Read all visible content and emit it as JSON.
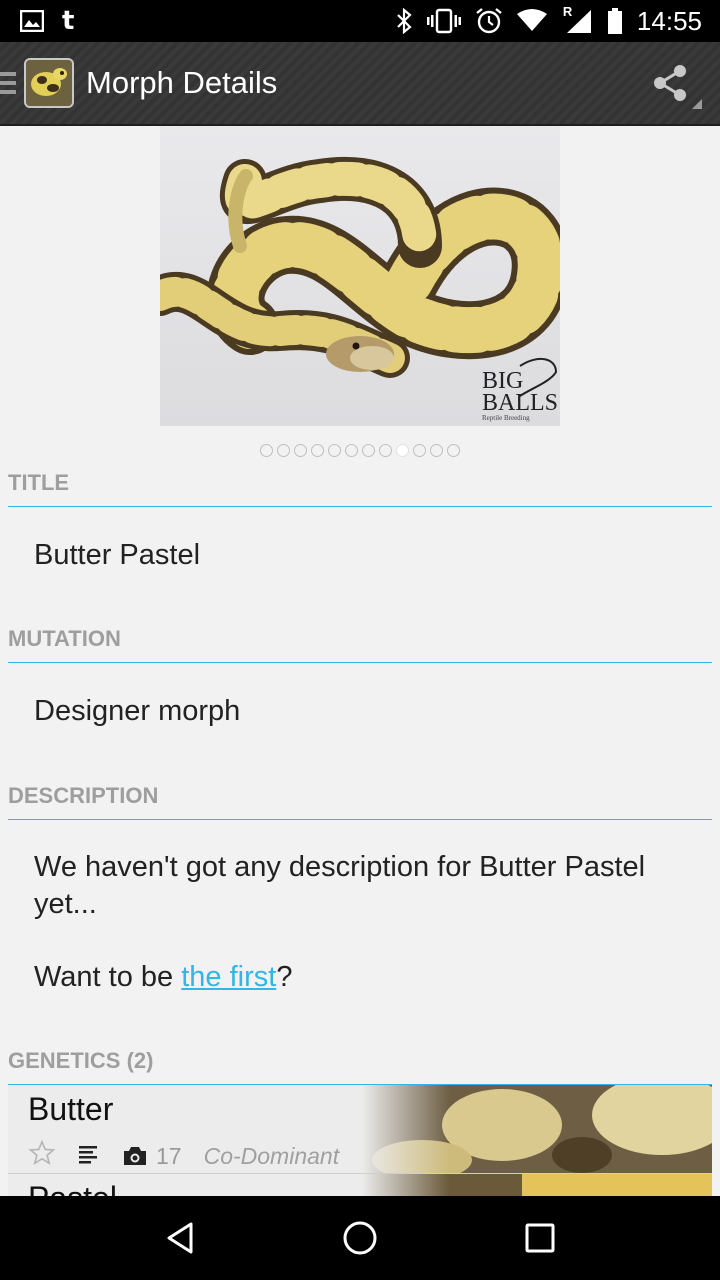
{
  "status_bar": {
    "time": "14:55",
    "left_icons": [
      "image-icon",
      "tumblr-icon"
    ],
    "right_icons": [
      "bluetooth-icon",
      "vibrate-icon",
      "alarm-icon",
      "wifi-icon",
      "signal-roaming-icon",
      "battery-icon"
    ],
    "tumblr_glyph": "t",
    "roaming_label": "R"
  },
  "action_bar": {
    "title": "Morph Details"
  },
  "gallery": {
    "watermark_line1": "BIG",
    "watermark_line2": "BALLS",
    "watermark_line3": "Reptile Breeding",
    "page_count": 12,
    "active_index": 8
  },
  "sections": {
    "title_header": "TITLE",
    "title_value": "Butter Pastel",
    "mutation_header": "MUTATION",
    "mutation_value": "Designer morph",
    "description_header": "DESCRIPTION",
    "description_text": "We haven't got any description for Butter Pastel yet...",
    "cta_prefix": "Want to be ",
    "cta_link": "the first",
    "cta_suffix": "?",
    "genetics_header": "GENETICS (2)"
  },
  "genetics": [
    {
      "name": "Butter",
      "photo_count": "17",
      "type": "Co-Dominant"
    },
    {
      "name": "Pastel"
    }
  ],
  "colors": {
    "accent": "#33b5e5",
    "header_text": "#9e9e9e",
    "action_bar": "#363636"
  }
}
